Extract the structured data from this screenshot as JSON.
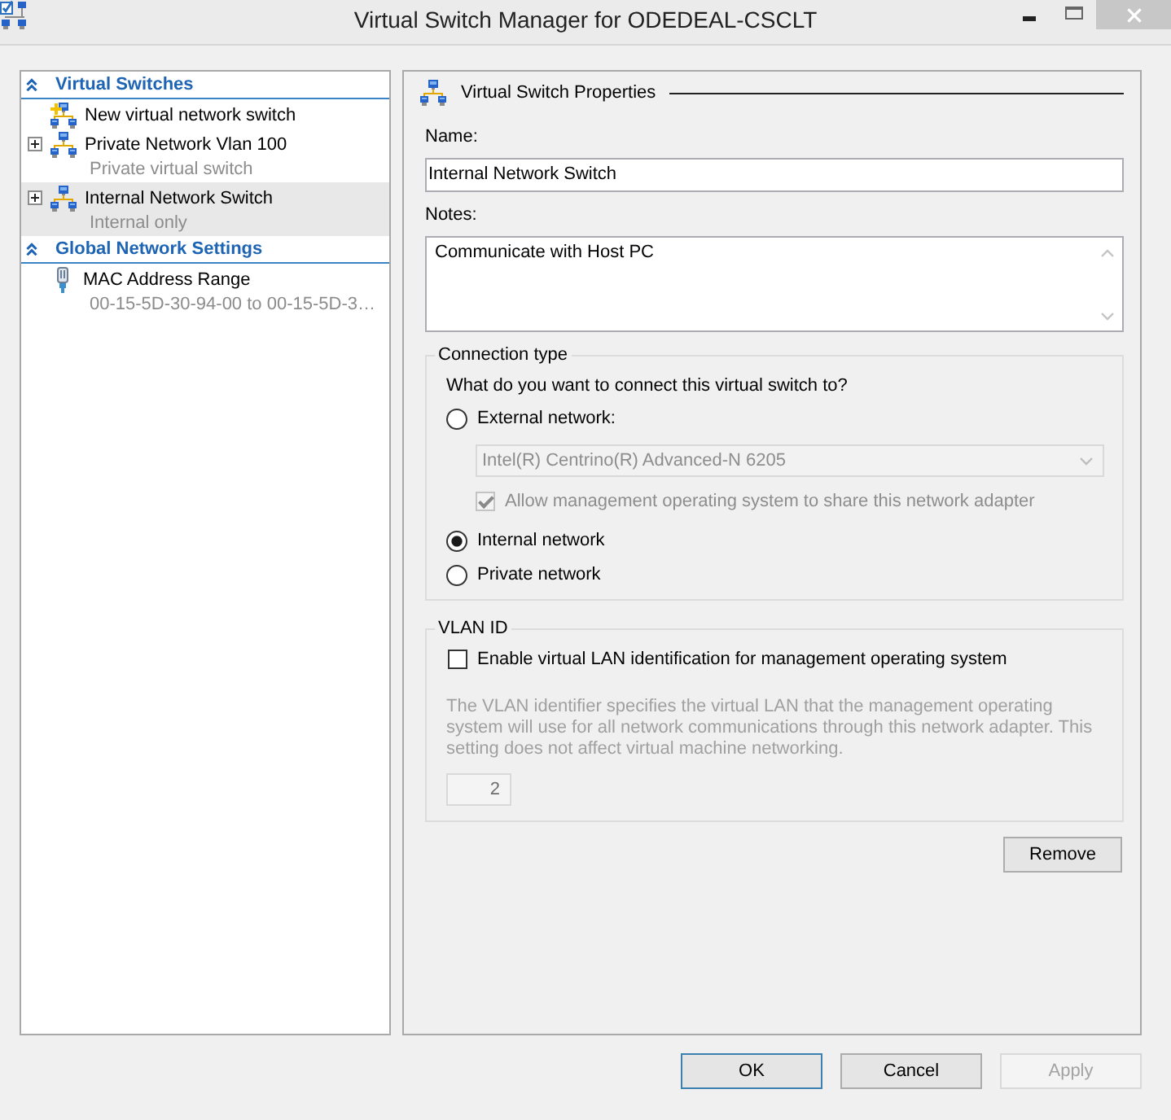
{
  "window": {
    "title": "Virtual Switch Manager for ODEDEAL-CSCLT"
  },
  "sidebar": {
    "sections": [
      {
        "title": "Virtual Switches",
        "expanded": true,
        "items": [
          {
            "kind": "new",
            "label": "New virtual network switch",
            "selected": false
          },
          {
            "kind": "switch",
            "label": "Private Network Vlan 100",
            "subtitle": "Private virtual switch",
            "expanded": false,
            "selected": false
          },
          {
            "kind": "switch",
            "label": "Internal Network Switch",
            "subtitle": "Internal only",
            "expanded": false,
            "selected": true
          }
        ]
      },
      {
        "title": "Global Network Settings",
        "expanded": true,
        "items": [
          {
            "kind": "setting",
            "label": "MAC Address Range",
            "subtitle": "00-15-5D-30-94-00 to 00-15-5D-3…",
            "selected": false
          }
        ]
      }
    ]
  },
  "properties": {
    "title": "Virtual Switch Properties",
    "name": {
      "label": "Name:",
      "value": "Internal Network Switch"
    },
    "notes": {
      "label": "Notes:",
      "value": "Communicate with Host PC"
    }
  },
  "connection_type": {
    "legend": "Connection type",
    "question": "What do you want to connect this virtual switch to?",
    "options": [
      {
        "label": "External network:",
        "selected": false,
        "adapter": {
          "value": "Intel(R) Centrino(R) Advanced-N 6205",
          "disabled": true
        },
        "share": {
          "label": "Allow management operating system to share this network adapter",
          "checked": true,
          "disabled": true
        }
      },
      {
        "label": "Internal network",
        "selected": true
      },
      {
        "label": "Private network",
        "selected": false
      }
    ]
  },
  "vlan": {
    "legend": "VLAN ID",
    "enable": {
      "label": "Enable virtual LAN identification for management operating system",
      "checked": false
    },
    "description": "The VLAN identifier specifies the virtual LAN that the management operating system will use for all network communications through this network adapter. This setting does not affect virtual machine networking.",
    "id": {
      "value": "2",
      "disabled": true
    }
  },
  "remove_button": {
    "label": "Remove"
  },
  "buttons": [
    {
      "label": "OK",
      "default": true,
      "disabled": false
    },
    {
      "label": "Cancel",
      "default": false,
      "disabled": false
    },
    {
      "label": "Apply",
      "default": false,
      "disabled": true
    }
  ]
}
